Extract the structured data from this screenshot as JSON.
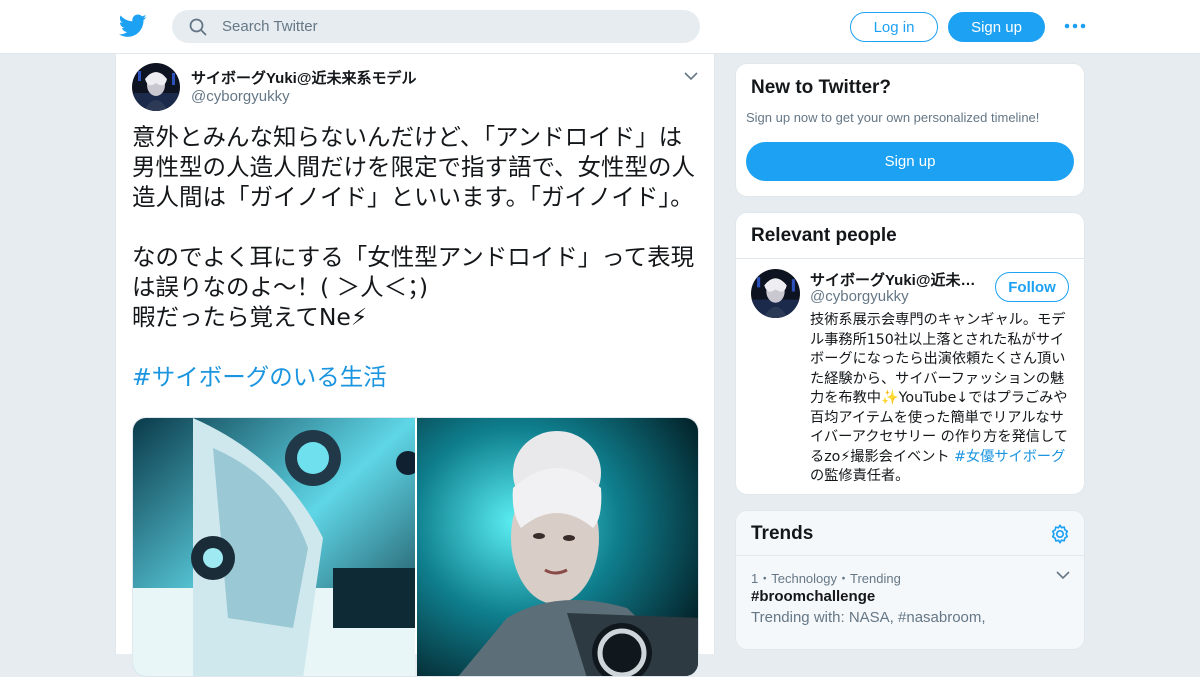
{
  "header": {
    "logo_icon": "twitter-bird-icon",
    "search_placeholder": "Search Twitter",
    "login_label": "Log in",
    "signup_label": "Sign up",
    "more_icon": "more-dots-icon",
    "brand_color": "#1da1f2"
  },
  "tweet": {
    "author_name": "サイボーグYuki@近未来系モデル",
    "author_handle": "@cyborgyukky",
    "text_1": "意外とみんな知らないんだけど、「アンドロイド」は男性型の人造人間だけを限定で指す語で、女性型の人造人間は「ガイノイド」といいます。「ガイノイド」。",
    "text_2": "なのでよく耳にする「女性型アンドロイド」って表現は誤りなのよ～！( ＞人＜；)",
    "text_3": "暇だったら覚えてNe⚡",
    "hashtag": "#サイボーグのいる生活",
    "media_icon": "photo-icon"
  },
  "signup_box": {
    "title": "New to Twitter?",
    "subtitle": "Sign up now to get your own personalized timeline!",
    "button": "Sign up"
  },
  "relevant": {
    "title": "Relevant people",
    "name": "サイボーグYuki@近未来系モデル",
    "handle": "@cyborgyukky",
    "follow_label": "Follow",
    "bio_1": "技術系展示会専門のキャンギャル。モデル事務所150社以上落とされた私がサイボーグになったら出演依頼たくさん頂いた経験から、サイバーファッションの魅力を布教中✨YouTube↓ではプラごみや百均アイテムを使った簡単でリアルなサイバーアクセサリー の作り方を発信してるzo⚡撮影会イベント ",
    "bio_hashtag": "#女優サイボーグ",
    "bio_2": " の監修責任者。"
  },
  "trends": {
    "title": "Trends",
    "settings_icon": "gear-icon",
    "items": [
      {
        "meta": "1・Technology・Trending",
        "name": "#broomchallenge",
        "with": "Trending with: NASA, #nasabroom,"
      }
    ]
  }
}
